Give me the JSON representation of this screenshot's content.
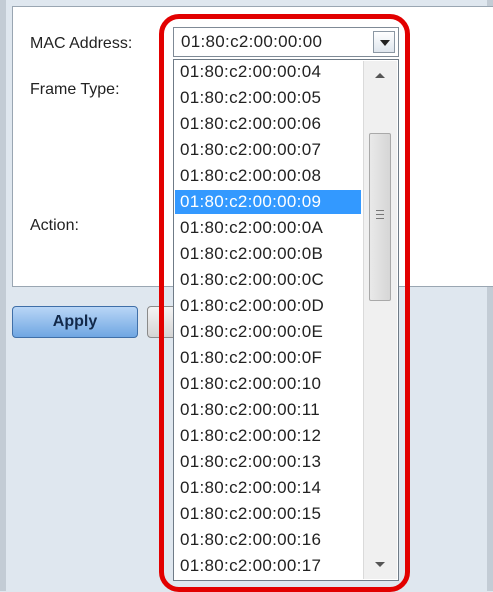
{
  "form": {
    "mac_address_label": "MAC Address:",
    "frame_type_label": "Frame Type:",
    "action_label": "Action:"
  },
  "mac_select": {
    "selected_value": "01:80:c2:00:00:00"
  },
  "dropdown": {
    "selected_option": "01:80:c2:00:00:09",
    "visible_options": [
      "01:80:c2:00:00:04",
      "01:80:c2:00:00:05",
      "01:80:c2:00:00:06",
      "01:80:c2:00:00:07",
      "01:80:c2:00:00:08",
      "01:80:c2:00:00:09",
      "01:80:c2:00:00:0A",
      "01:80:c2:00:00:0B",
      "01:80:c2:00:00:0C",
      "01:80:c2:00:00:0D",
      "01:80:c2:00:00:0E",
      "01:80:c2:00:00:0F",
      "01:80:c2:00:00:10",
      "01:80:c2:00:00:11",
      "01:80:c2:00:00:12",
      "01:80:c2:00:00:13",
      "01:80:c2:00:00:14",
      "01:80:c2:00:00:15",
      "01:80:c2:00:00:16",
      "01:80:c2:00:00:17"
    ]
  },
  "buttons": {
    "apply_label": "Apply"
  },
  "colors": {
    "selection": "#3399ff",
    "highlight_ring": "#e20000"
  }
}
